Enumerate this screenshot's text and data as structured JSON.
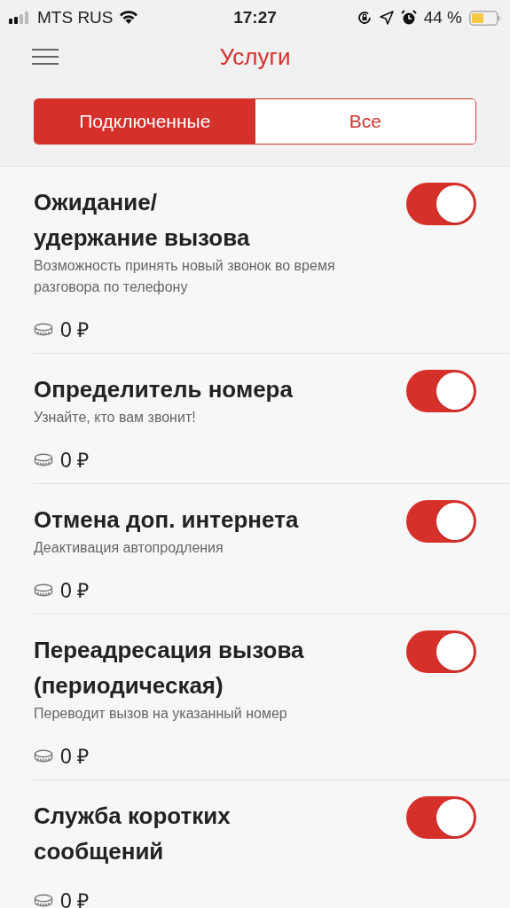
{
  "status_bar": {
    "carrier": "MTS RUS",
    "time": "17:27",
    "battery": "44 %"
  },
  "header": {
    "title": "Услуги"
  },
  "tabs": [
    {
      "label": "Подключенные",
      "selected": true
    },
    {
      "label": "Все",
      "selected": false
    }
  ],
  "services": [
    {
      "title": "Ожидание/\nудержание вызова",
      "description": "Возможность принять новый звонок во время разговора по телефону",
      "price": "0 ₽",
      "on": true
    },
    {
      "title": "Определитель номера",
      "description": "Узнайте, кто вам звонит!",
      "price": "0 ₽",
      "on": true
    },
    {
      "title": "Отмена доп. интернета",
      "description": "Деактивация автопродления",
      "price": "0 ₽",
      "on": true
    },
    {
      "title": "Переадресация вызова\n(периодическая)",
      "description": "Переводит вызов на указанный номер",
      "price": "0 ₽",
      "on": true
    },
    {
      "title": "Служба коротких\nсообщений",
      "price": "0 ₽",
      "on": true
    }
  ]
}
